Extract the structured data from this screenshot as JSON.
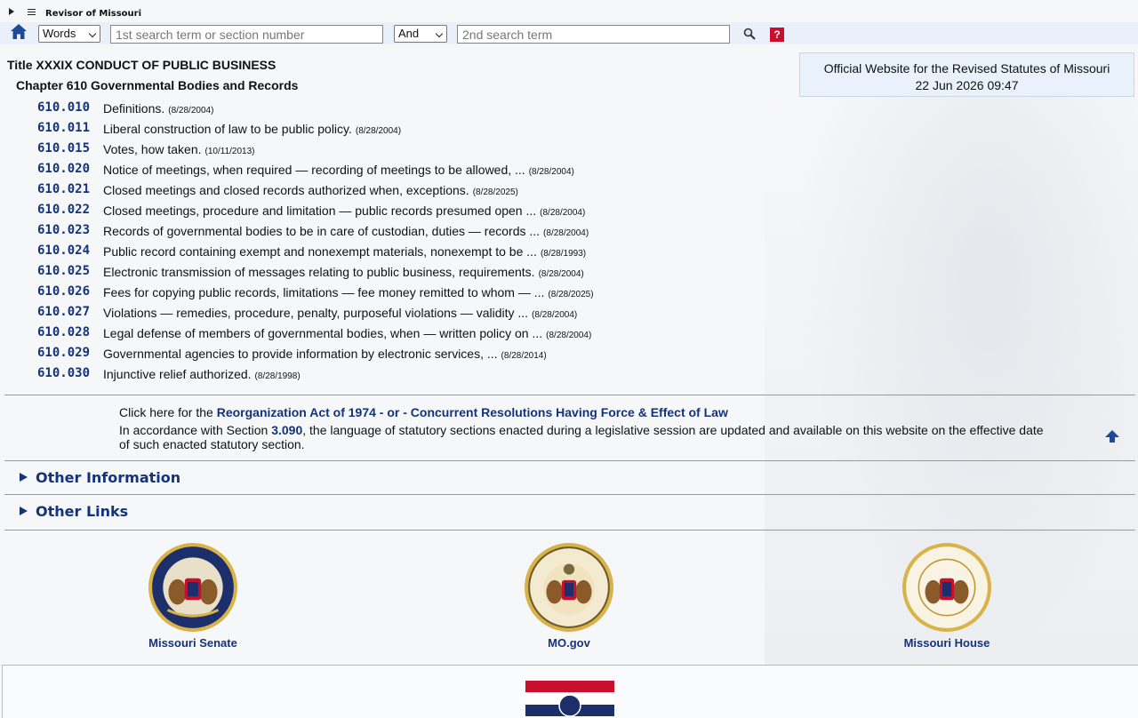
{
  "header": {
    "brand": "Revisor of Missouri"
  },
  "search": {
    "mode": "Words",
    "term1_placeholder": "1st search term or section number",
    "operator": "And",
    "term2_placeholder": "2nd search term",
    "help_label": "?"
  },
  "official": {
    "line1": "Official Website for the Revised Statutes of Missouri",
    "datetime": "22 Jun 2026 09:47"
  },
  "title": "Title XXXIX CONDUCT OF PUBLIC BUSINESS",
  "chapter": "Chapter 610 Governmental Bodies and Records",
  "sections": [
    {
      "num": "610.010",
      "text": "Definitions.",
      "date": "(8/28/2004)"
    },
    {
      "num": "610.011",
      "text": "Liberal construction of law to be public policy.",
      "date": "(8/28/2004)"
    },
    {
      "num": "610.015",
      "text": "Votes, how taken.",
      "date": "(10/11/2013)"
    },
    {
      "num": "610.020",
      "text": "Notice of meetings, when required — recording of meetings to be allowed, ...",
      "date": "(8/28/2004)"
    },
    {
      "num": "610.021",
      "text": "Closed meetings and closed records authorized when, exceptions.",
      "date": "(8/28/2025)"
    },
    {
      "num": "610.022",
      "text": "Closed meetings, procedure and limitation — public records presumed open ...",
      "date": "(8/28/2004)"
    },
    {
      "num": "610.023",
      "text": "Records of governmental bodies to be in care of custodian, duties — records ...",
      "date": "(8/28/2004)"
    },
    {
      "num": "610.024",
      "text": "Public record containing exempt and nonexempt materials, nonexempt to be ...",
      "date": "(8/28/1993)"
    },
    {
      "num": "610.025",
      "text": "Electronic transmission of messages relating to public business, requirements.",
      "date": "(8/28/2004)"
    },
    {
      "num": "610.026",
      "text": "Fees for copying public records, limitations — fee money remitted to whom — ...",
      "date": "(8/28/2025)"
    },
    {
      "num": "610.027",
      "text": "Violations — remedies, procedure, penalty, purposeful violations — validity ...",
      "date": "(8/28/2004)"
    },
    {
      "num": "610.028",
      "text": "Legal defense of members of governmental bodies, when — written policy on ...",
      "date": "(8/28/2004)"
    },
    {
      "num": "610.029",
      "text": "Governmental agencies to provide information by electronic services, ...",
      "date": "(8/28/2014)"
    },
    {
      "num": "610.030",
      "text": "Injunctive relief authorized.",
      "date": "(8/28/1998)"
    }
  ],
  "notice": {
    "prefix": "Click here for the",
    "reorg_link": "Reorganization Act of 1974",
    "sep": "- or -",
    "concurrent_link": "Concurrent Resolutions Having Force & Effect of Law",
    "text_before": "In accordance with Section",
    "section_link": "3.090",
    "text_after": ", the language of statutory sections enacted during a legislative session are updated and available on this website on the effective date of such enacted statutory section."
  },
  "expanders": {
    "other_info": "Other Information",
    "other_links": "Other Links"
  },
  "footer": {
    "senate": "Missouri Senate",
    "mogov": "MO.gov",
    "house": "Missouri House"
  }
}
